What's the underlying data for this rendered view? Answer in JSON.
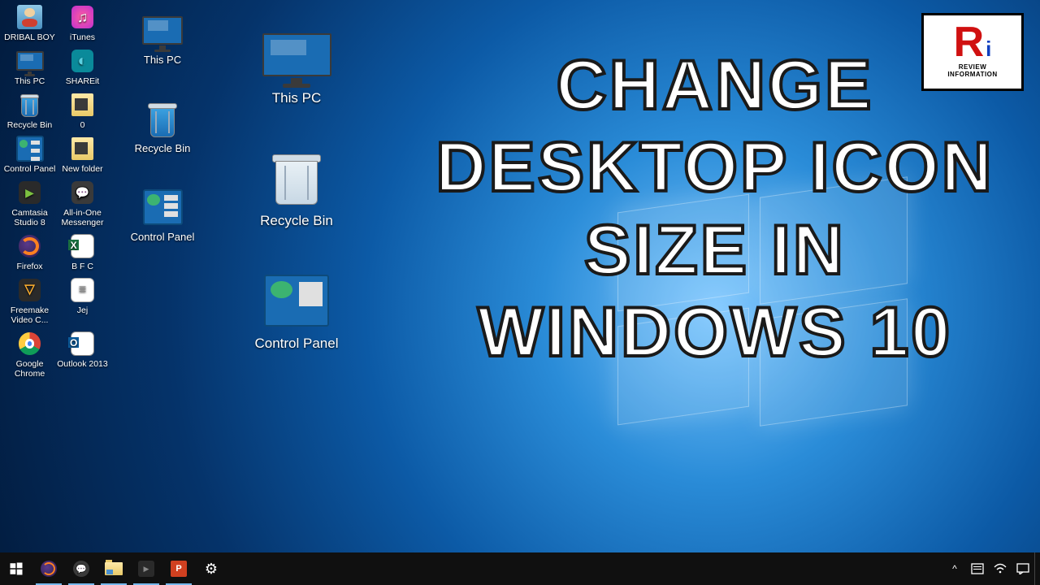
{
  "desktop_icons_small": {
    "col1": [
      "DRIBAL BOY",
      "This PC",
      "Recycle Bin",
      "Control Panel",
      "Camtasia Studio 8",
      "Firefox",
      "Freemake Video C...",
      "Google Chrome"
    ],
    "col2": [
      "iTunes",
      "SHAREit",
      "0",
      "New folder",
      "All-in-One Messenger",
      "B F C",
      "Jej",
      "Outlook 2013"
    ]
  },
  "desktop_icons_medium": [
    "This PC",
    "Recycle Bin",
    "Control Panel"
  ],
  "desktop_icons_large": [
    "This PC",
    "Recycle Bin",
    "Control Panel"
  ],
  "overlay": {
    "l1": "CHANGE",
    "l2": "DESKTOP ICON",
    "l3": "SIZE IN",
    "l4": "WINDOWS 10"
  },
  "badge": {
    "brand_r": "R",
    "brand_i": "i",
    "line1": "REVIEW",
    "line2": "INFORMATION"
  },
  "tray": {
    "chevron": "^"
  }
}
